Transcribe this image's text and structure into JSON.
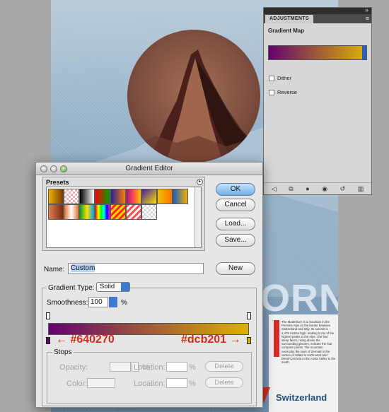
{
  "poster": {
    "title_fragment": "ORN",
    "card_text": "The Matterhorn is a mountain in the Pennine Alps on the border between Switzerland and Italy. Its summit is 4,478 metres high, making it one of the highest peaks in the Alps. The four steep faces, rising above the surrounding glaciers, indicate the four compass points. The mountain overlooks the town of Zermatt in the canton of Valais to north-west and Breuil-Cervinia in the Aosta Valley to the south.",
    "brand": "Switzerland"
  },
  "adjustments": {
    "tab": "ADJUSTMENTS",
    "title": "Gradient Map",
    "dither": "Dither",
    "reverse": "Reverse",
    "gradient_from": "#640270",
    "gradient_to": "#dcb201"
  },
  "editor": {
    "window_title": "Gradient Editor",
    "presets_label": "Presets",
    "buttons": {
      "ok": "OK",
      "cancel": "Cancel",
      "load": "Load...",
      "save": "Save...",
      "new": "New"
    },
    "name_label": "Name:",
    "name_value": "Custom",
    "gradient_type_label": "Gradient Type:",
    "gradient_type_value": "Solid",
    "smoothness_label": "Smoothness:",
    "smoothness_value": "100",
    "smoothness_unit": "%",
    "color_left": "#640270",
    "color_right": "#dcb201",
    "stops": {
      "label": "Stops",
      "opacity_label": "Opacity:",
      "color_label": "Color:",
      "location_label": "Location:",
      "percent": "%",
      "delete_label": "Delete"
    }
  },
  "icons": {
    "adj_footer": [
      "back-arrow-icon",
      "clip-layer-icon",
      "eye-icon",
      "view-previous-icon",
      "reset-icon",
      "trash-icon"
    ]
  }
}
